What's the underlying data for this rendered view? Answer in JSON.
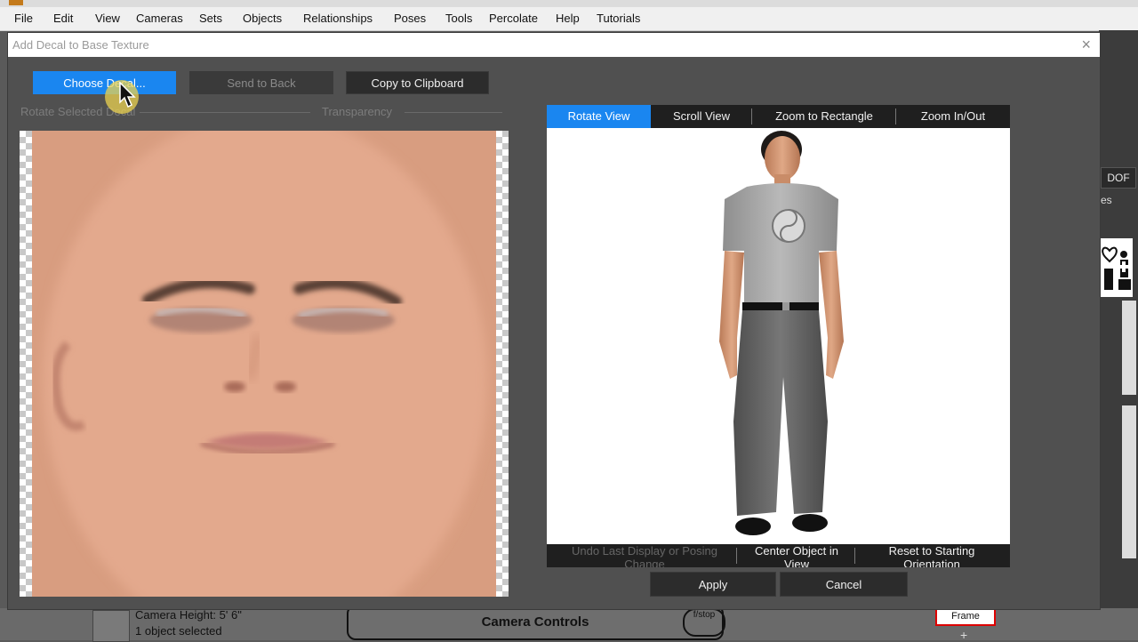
{
  "menu": [
    "File",
    "Edit",
    "View",
    "Cameras",
    "Sets",
    "Objects",
    "Relationships",
    "Poses",
    "Tools",
    "Percolate",
    "Help",
    "Tutorials"
  ],
  "dialog": {
    "title": "Add Decal to Base Texture",
    "close_glyph": "×",
    "buttons": {
      "choose_decal": "Choose Decal...",
      "send_to_back": "Send to Back",
      "copy_to_clipboard": "Copy to Clipboard"
    },
    "sliders": {
      "rotate_selected_decal": "Rotate Selected Decal",
      "transparency": "Transparency"
    },
    "view_tabs": [
      "Rotate View",
      "Scroll View",
      "Zoom to Rectangle",
      "Zoom In/Out"
    ],
    "view_actions": {
      "undo": "Undo Last Display or Posing Change",
      "center": "Center Object in View",
      "reset": "Reset to Starting Orientation"
    },
    "apply": "Apply",
    "cancel": "Cancel"
  },
  "background": {
    "dof": "DOF",
    "es": "es",
    "camera_height": "Camera Height: 5' 6\"",
    "objects_selected": "1 object selected",
    "camera_controls": "Camera Controls",
    "fstop": "f/stop",
    "frame": "Frame",
    "plus": "+"
  },
  "colors": {
    "accent": "#1a86f0",
    "dialog_bg": "#505050",
    "skin": "#dea283"
  }
}
